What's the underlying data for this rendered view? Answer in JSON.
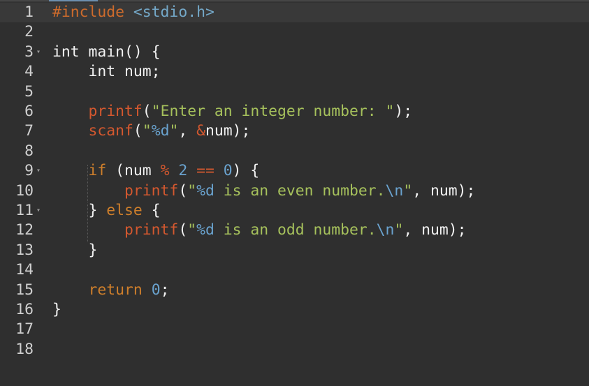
{
  "editor": {
    "line_numbers": [
      "1",
      "2",
      "3",
      "4",
      "5",
      "6",
      "7",
      "8",
      "9",
      "10",
      "11",
      "12",
      "13",
      "14",
      "15",
      "16",
      "17",
      "18"
    ],
    "fold_markers": [
      "▾",
      "▾",
      "▾"
    ],
    "lines": [
      [
        {
          "t": "#include",
          "c": "tok-pre"
        },
        {
          "t": " ",
          "c": "tok-plain"
        },
        {
          "t": "<stdio.h>",
          "c": "tok-inc"
        }
      ],
      [],
      [
        {
          "t": "int",
          "c": "tok-plain"
        },
        {
          "t": " main() {",
          "c": "tok-plain"
        }
      ],
      [
        {
          "t": "    int num;",
          "c": "tok-plain"
        }
      ],
      [],
      [
        {
          "t": "    ",
          "c": "tok-plain"
        },
        {
          "t": "printf",
          "c": "tok-fn"
        },
        {
          "t": "(",
          "c": "tok-plain"
        },
        {
          "t": "\"Enter an integer number: \"",
          "c": "tok-str"
        },
        {
          "t": ");",
          "c": "tok-plain"
        }
      ],
      [
        {
          "t": "    ",
          "c": "tok-plain"
        },
        {
          "t": "scanf",
          "c": "tok-fn"
        },
        {
          "t": "(",
          "c": "tok-plain"
        },
        {
          "t": "\"",
          "c": "tok-str"
        },
        {
          "t": "%d",
          "c": "tok-fmt"
        },
        {
          "t": "\"",
          "c": "tok-str"
        },
        {
          "t": ", ",
          "c": "tok-plain"
        },
        {
          "t": "&",
          "c": "tok-op"
        },
        {
          "t": "num);",
          "c": "tok-plain"
        }
      ],
      [],
      [
        {
          "t": "    ",
          "c": "tok-plain"
        },
        {
          "t": "if",
          "c": "tok-kw"
        },
        {
          "t": " (num ",
          "c": "tok-plain"
        },
        {
          "t": "%",
          "c": "tok-op"
        },
        {
          "t": " ",
          "c": "tok-plain"
        },
        {
          "t": "2",
          "c": "tok-num"
        },
        {
          "t": " ",
          "c": "tok-plain"
        },
        {
          "t": "==",
          "c": "tok-op"
        },
        {
          "t": " ",
          "c": "tok-plain"
        },
        {
          "t": "0",
          "c": "tok-num"
        },
        {
          "t": ") {",
          "c": "tok-plain"
        }
      ],
      [
        {
          "t": "        ",
          "c": "tok-plain"
        },
        {
          "t": "printf",
          "c": "tok-fn"
        },
        {
          "t": "(",
          "c": "tok-plain"
        },
        {
          "t": "\"",
          "c": "tok-str"
        },
        {
          "t": "%d",
          "c": "tok-fmt"
        },
        {
          "t": " is an even number.",
          "c": "tok-str"
        },
        {
          "t": "\\n",
          "c": "tok-fmt"
        },
        {
          "t": "\"",
          "c": "tok-str"
        },
        {
          "t": ", num);",
          "c": "tok-plain"
        }
      ],
      [
        {
          "t": "    } ",
          "c": "tok-plain"
        },
        {
          "t": "else",
          "c": "tok-kw"
        },
        {
          "t": " {",
          "c": "tok-plain"
        }
      ],
      [
        {
          "t": "        ",
          "c": "tok-plain"
        },
        {
          "t": "printf",
          "c": "tok-fn"
        },
        {
          "t": "(",
          "c": "tok-plain"
        },
        {
          "t": "\"",
          "c": "tok-str"
        },
        {
          "t": "%d",
          "c": "tok-fmt"
        },
        {
          "t": " is an odd number.",
          "c": "tok-str"
        },
        {
          "t": "\\n",
          "c": "tok-fmt"
        },
        {
          "t": "\"",
          "c": "tok-str"
        },
        {
          "t": ", num);",
          "c": "tok-plain"
        }
      ],
      [
        {
          "t": "    }",
          "c": "tok-plain"
        }
      ],
      [],
      [
        {
          "t": "    ",
          "c": "tok-plain"
        },
        {
          "t": "return",
          "c": "tok-kw"
        },
        {
          "t": " ",
          "c": "tok-plain"
        },
        {
          "t": "0",
          "c": "tok-num"
        },
        {
          "t": ";",
          "c": "tok-plain"
        }
      ],
      [
        {
          "t": "}",
          "c": "tok-plain"
        }
      ],
      [],
      []
    ]
  },
  "theme": {
    "background": "#2f2f2f",
    "active_line": "#393939",
    "keyword": "#cf7f2b",
    "function": "#d4582f",
    "string": "#a6c15c",
    "number": "#6aa3cf"
  }
}
